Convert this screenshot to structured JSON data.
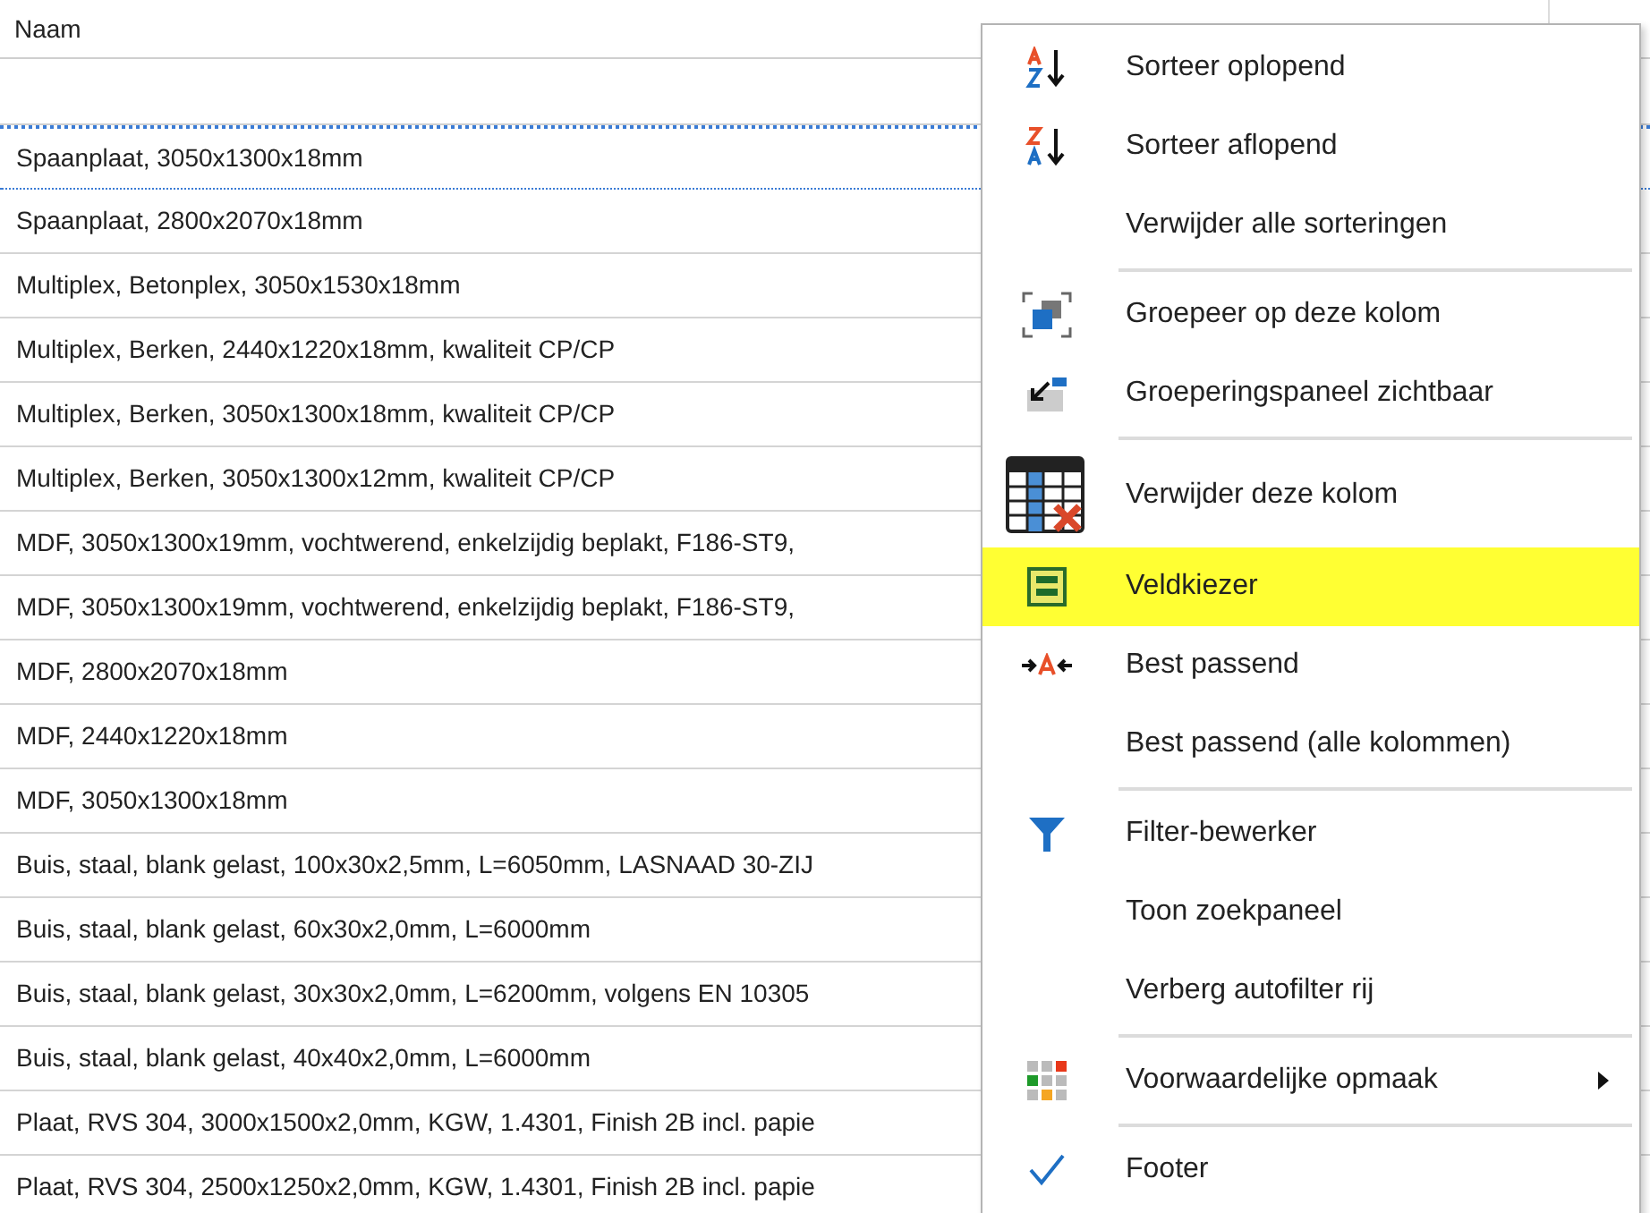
{
  "grid": {
    "column_header": "Naam",
    "rows": [
      {
        "text": "Spaanplaat, 3050x1300x18mm",
        "focused": true
      },
      {
        "text": "Spaanplaat, 2800x2070x18mm",
        "focused": false
      },
      {
        "text": "Multiplex, Betonplex, 3050x1530x18mm",
        "focused": false
      },
      {
        "text": "Multiplex, Berken, 2440x1220x18mm, kwaliteit CP/CP",
        "focused": false
      },
      {
        "text": "Multiplex, Berken, 3050x1300x18mm, kwaliteit CP/CP",
        "focused": false
      },
      {
        "text": "Multiplex, Berken, 3050x1300x12mm, kwaliteit CP/CP",
        "focused": false
      },
      {
        "text": "MDF, 3050x1300x19mm, vochtwerend, enkelzijdig beplakt, F186-ST9,",
        "focused": false
      },
      {
        "text": "MDF, 3050x1300x19mm, vochtwerend, enkelzijdig beplakt, F186-ST9,",
        "focused": false
      },
      {
        "text": "MDF, 2800x2070x18mm",
        "focused": false
      },
      {
        "text": "MDF, 2440x1220x18mm",
        "focused": false
      },
      {
        "text": "MDF, 3050x1300x18mm",
        "focused": false
      },
      {
        "text": "Buis, staal, blank gelast, 100x30x2,5mm, L=6050mm, LASNAAD 30-ZIJ",
        "focused": false
      },
      {
        "text": "Buis, staal, blank gelast, 60x30x2,0mm, L=6000mm",
        "focused": false
      },
      {
        "text": "Buis, staal, blank gelast, 30x30x2,0mm, L=6200mm, volgens EN 10305",
        "focused": false
      },
      {
        "text": "Buis, staal, blank gelast, 40x40x2,0mm, L=6000mm",
        "focused": false
      },
      {
        "text": "Plaat, RVS 304, 3000x1500x2,0mm, KGW, 1.4301, Finish 2B  incl. papie",
        "focused": false
      },
      {
        "text": "Plaat, RVS 304, 2500x1250x2,0mm, KGW, 1.4301, Finish 2B  incl. papie",
        "focused": false
      }
    ]
  },
  "context_menu": {
    "groups": [
      [
        {
          "label": "Sorteer oplopend",
          "selected": false
        },
        {
          "label": "Sorteer aflopend",
          "selected": false
        },
        {
          "label": "Verwijder alle sorteringen",
          "selected": false
        }
      ],
      [
        {
          "label": "Groepeer op deze kolom",
          "selected": false
        },
        {
          "label": "Groeperingspaneel zichtbaar",
          "selected": false
        }
      ],
      [
        {
          "label": "Verwijder deze kolom",
          "selected": false
        },
        {
          "label": "Veldkiezer",
          "selected": true
        },
        {
          "label": "Best passend",
          "selected": false
        },
        {
          "label": "Best passend (alle kolommen)",
          "selected": false
        }
      ],
      [
        {
          "label": "Filter-bewerker",
          "selected": false
        },
        {
          "label": "Toon zoekpaneel",
          "selected": false
        },
        {
          "label": "Verberg autofilter rij",
          "selected": false
        }
      ],
      [
        {
          "label": "Voorwaardelijke opmaak",
          "selected": false,
          "submenu": true
        }
      ],
      [
        {
          "label": "Footer",
          "selected": false,
          "checked": true
        }
      ]
    ]
  }
}
